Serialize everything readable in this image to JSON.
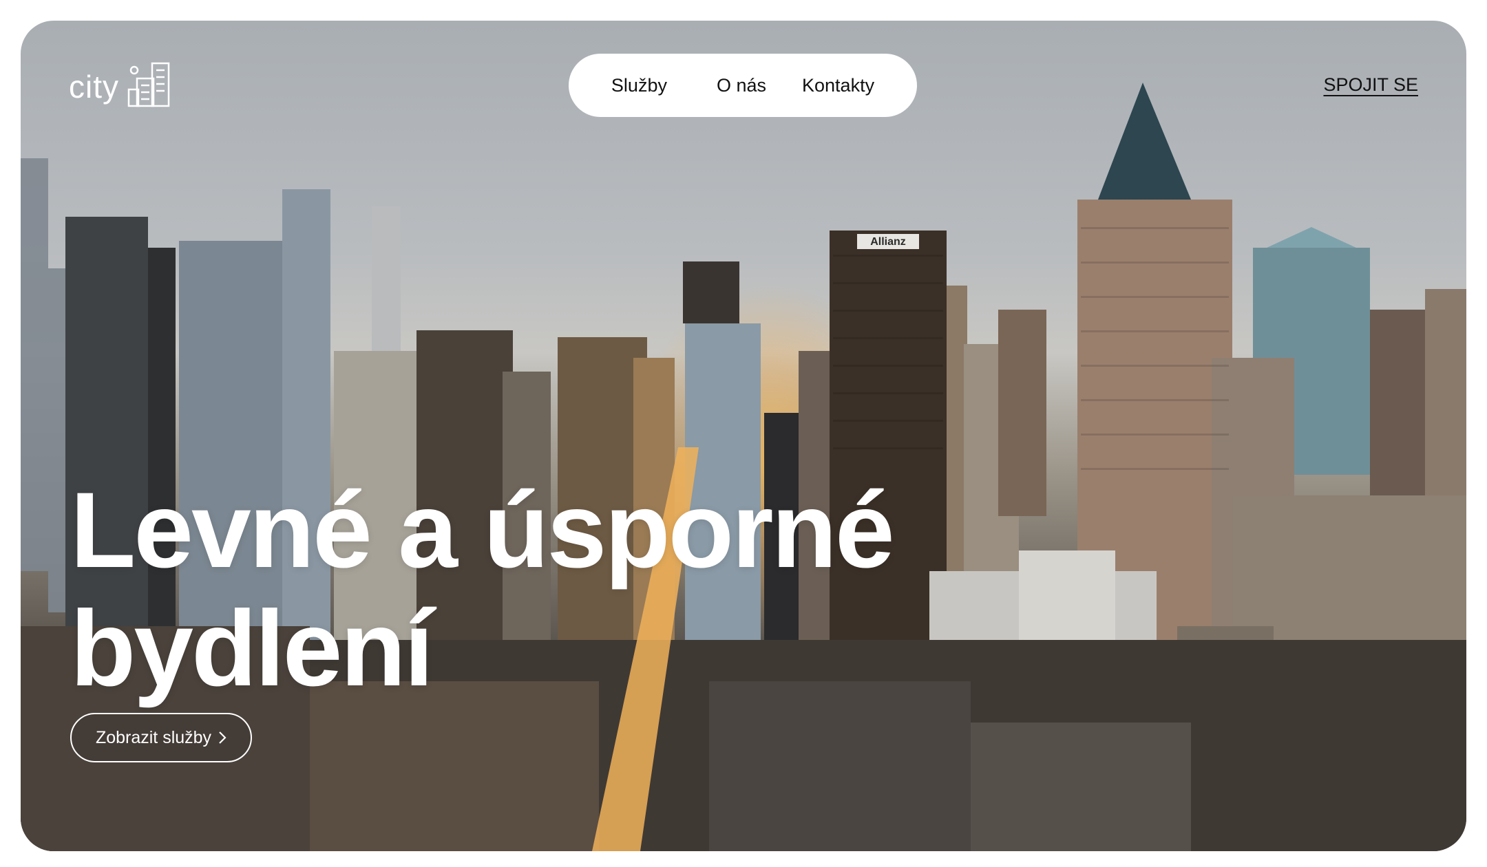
{
  "header": {
    "logo_text": "city",
    "logo_icon": "city-buildings-icon",
    "nav": {
      "items": [
        {
          "label": "Služby"
        },
        {
          "label": "O nás"
        },
        {
          "label": "Kontakty"
        }
      ]
    },
    "connect_label": "SPOJIT SE"
  },
  "hero": {
    "headline_line1": "Levné a úsporné",
    "headline_line2": "bydlení",
    "cta_label": "Zobrazit služby",
    "cta_icon": "chevron-right-icon",
    "background_image": "city-skyline-photo",
    "building_sign": "Allianz"
  },
  "colors": {
    "nav_bg": "#ffffff",
    "text_dark": "#111111",
    "text_light": "#ffffff"
  }
}
